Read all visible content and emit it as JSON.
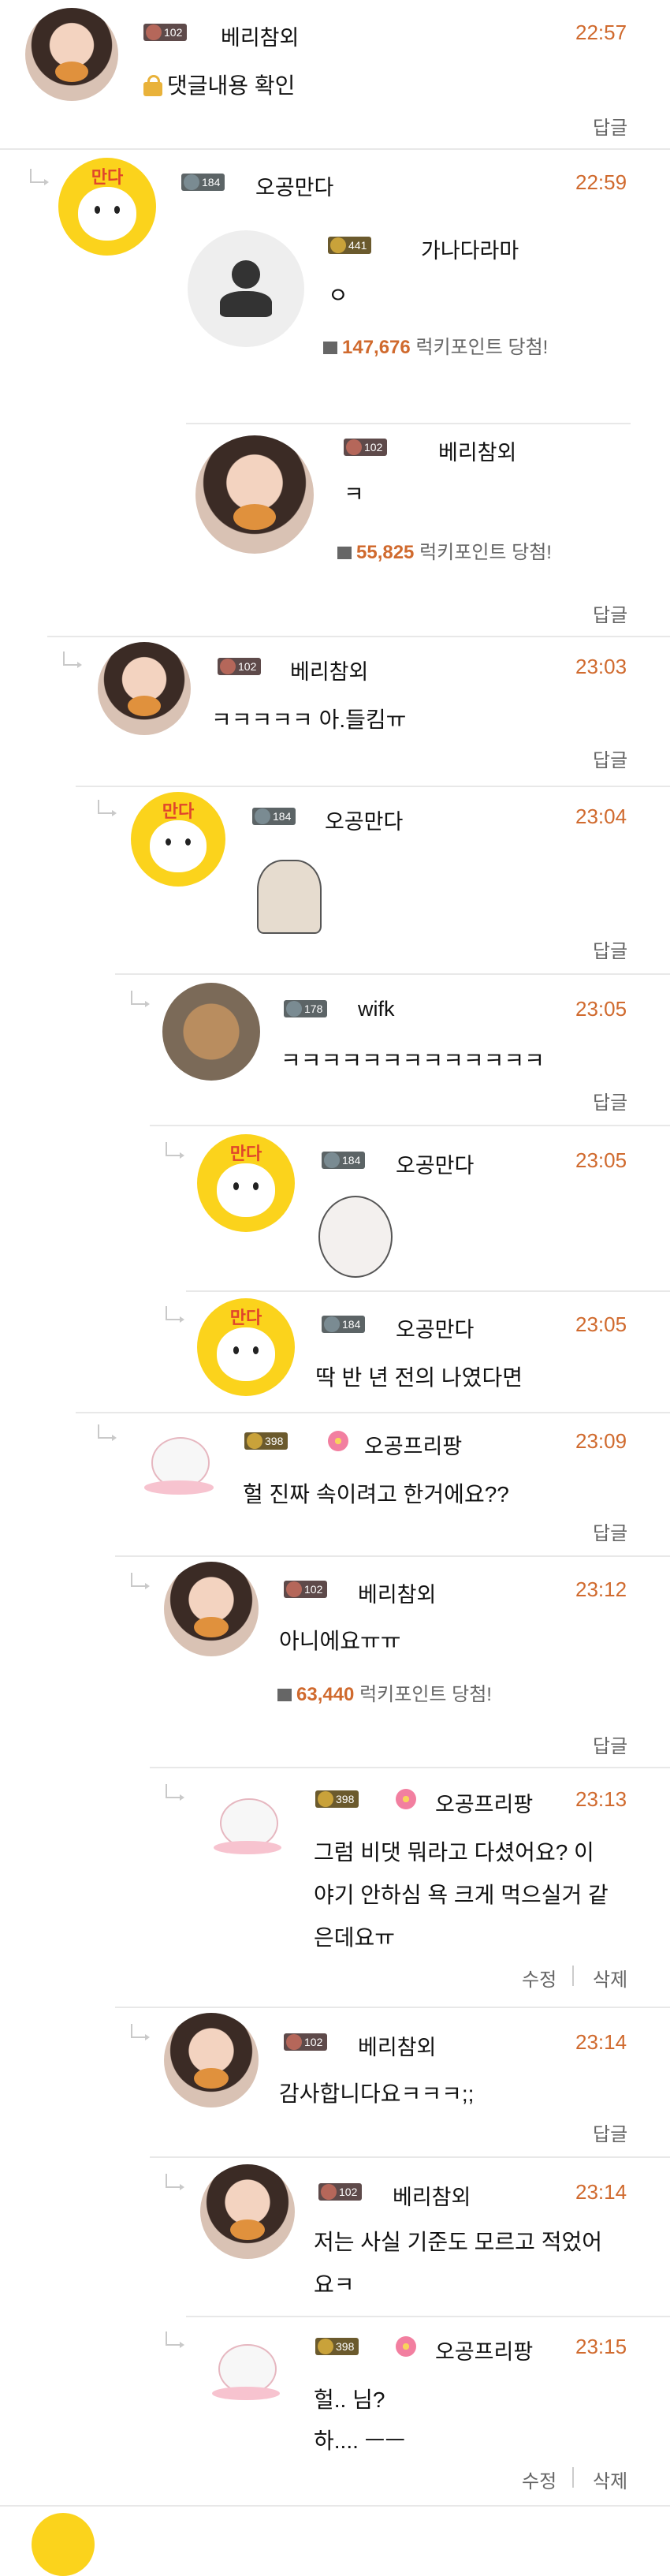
{
  "reply_label": "답글",
  "edit_label": "수정",
  "delete_label": "삭제",
  "win_suffix": "럭키포인트 당첨!",
  "colors": {
    "time": "#d06a2e",
    "accent_orange": "#d06a2e",
    "separator": "#e8e8e8"
  },
  "c1": {
    "level": "102",
    "nick": "베리참외",
    "time": "22:57",
    "text": "댓글내용 확인"
  },
  "c2": {
    "level": "184",
    "nick": "오공만다",
    "time": "22:59"
  },
  "q1": {
    "level": "441",
    "nick": "가나다라마",
    "text": "ㅇ",
    "win": "147,676"
  },
  "q2": {
    "level": "102",
    "nick": "베리참외",
    "text": "ㅋ",
    "win": "55,825"
  },
  "c3": {
    "level": "102",
    "nick": "베리참외",
    "time": "23:03",
    "text": "ㅋㅋㅋㅋㅋ 아.들킴ㅠ"
  },
  "c4": {
    "level": "184",
    "nick": "오공만다",
    "time": "23:04"
  },
  "c5": {
    "level": "178",
    "nick": "wifk",
    "time": "23:05",
    "text": "ㅋㅋㅋㅋㅋㅋㅋㅋㅋㅋㅋㅋㅋ"
  },
  "c6": {
    "level": "184",
    "nick": "오공만다",
    "time": "23:05"
  },
  "c7": {
    "level": "184",
    "nick": "오공만다",
    "time": "23:05",
    "text": "딱 반 년 전의 나였다면"
  },
  "c8": {
    "level": "398",
    "nick": "오공프리팡",
    "time": "23:09",
    "text": "헐 진짜 속이려고 한거에요??"
  },
  "c9": {
    "level": "102",
    "nick": "베리참외",
    "time": "23:12",
    "text": "아니에요ㅠㅠ",
    "win": "63,440"
  },
  "c10": {
    "level": "398",
    "nick": "오공프리팡",
    "time": "23:13",
    "lines": [
      "그럼 비댓 뭐라고 다셨어요? 이",
      "야기 안하심 욕 크게 먹으실거 같",
      "은데요ㅠ"
    ]
  },
  "c11": {
    "level": "102",
    "nick": "베리참외",
    "time": "23:14",
    "text": "감사합니다요ㅋㅋㅋ;;"
  },
  "c12": {
    "level": "102",
    "nick": "베리참외",
    "time": "23:14",
    "lines": [
      "저는 사실 기준도 모르고 적었어",
      "요ㅋ"
    ]
  },
  "c13": {
    "level": "398",
    "nick": "오공프리팡",
    "time": "23:15",
    "lines": [
      "헐.. 님?",
      "하....  ㅡㅡ"
    ]
  }
}
